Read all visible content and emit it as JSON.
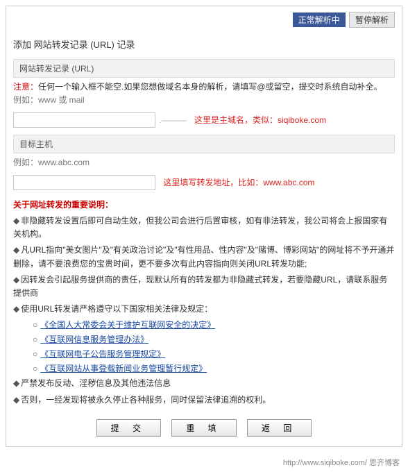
{
  "top": {
    "normal": "正常解析中",
    "pause": "暂停解析"
  },
  "title": "添加 网站转发记录 (URL) 记录",
  "sec1": {
    "header": "网站转发记录 (URL)",
    "notice_label": "注意：",
    "notice_text": "任何一个输入框不能空.如果您想做域名本身的解析，请填写@或留空，提交时系统自动补全。",
    "example": "例如：www 或 mail",
    "value": "",
    "suffix": ".———",
    "red": "这里是主域名，类似：siqiboke.com"
  },
  "sec2": {
    "header": "目标主机",
    "example": "例如：www.abc.com",
    "value": "",
    "red": "这里填写转发地址，比如：www.abc.com"
  },
  "important": {
    "title": "关于网址转发的重要说明：",
    "items": [
      "非隐藏转发设置后即可自动生效，但我公司会进行后置审核，如有非法转发，我公司将会上报国家有关机构。",
      "凡URL指向\"美女图片\"及\"有关政治讨论\"及\"有性用品、性内容\"及\"赌博、博彩网站\"的网址将不予开通并删除，请不要浪费您的宝贵时间，更不要多次有此内容指向则关闭URL转发功能;",
      "因转发会引起服务提供商的责任，现默认所有的转发都为非隐藏式转发，若要隐藏URL，请联系服务提供商",
      "使用URL转发请严格遵守以下国家相关法律及规定："
    ],
    "sublinks": [
      "《全国人大常委会关于维护互联网安全的决定》",
      "《互联网信息服务管理办法》",
      "《互联网电子公告服务管理规定》",
      "《互联网站从事登载新闻业务管理暂行规定》"
    ],
    "items2": [
      "严禁发布反动、淫秽信息及其他违法信息",
      "否则，一经发现将被永久停止各种服务，同时保留法律追溯的权利。"
    ]
  },
  "buttons": {
    "submit": "提 交",
    "reset": "重 填",
    "back": "返 回"
  },
  "footer": "http://www.siqiboke.com/  思齐博客"
}
